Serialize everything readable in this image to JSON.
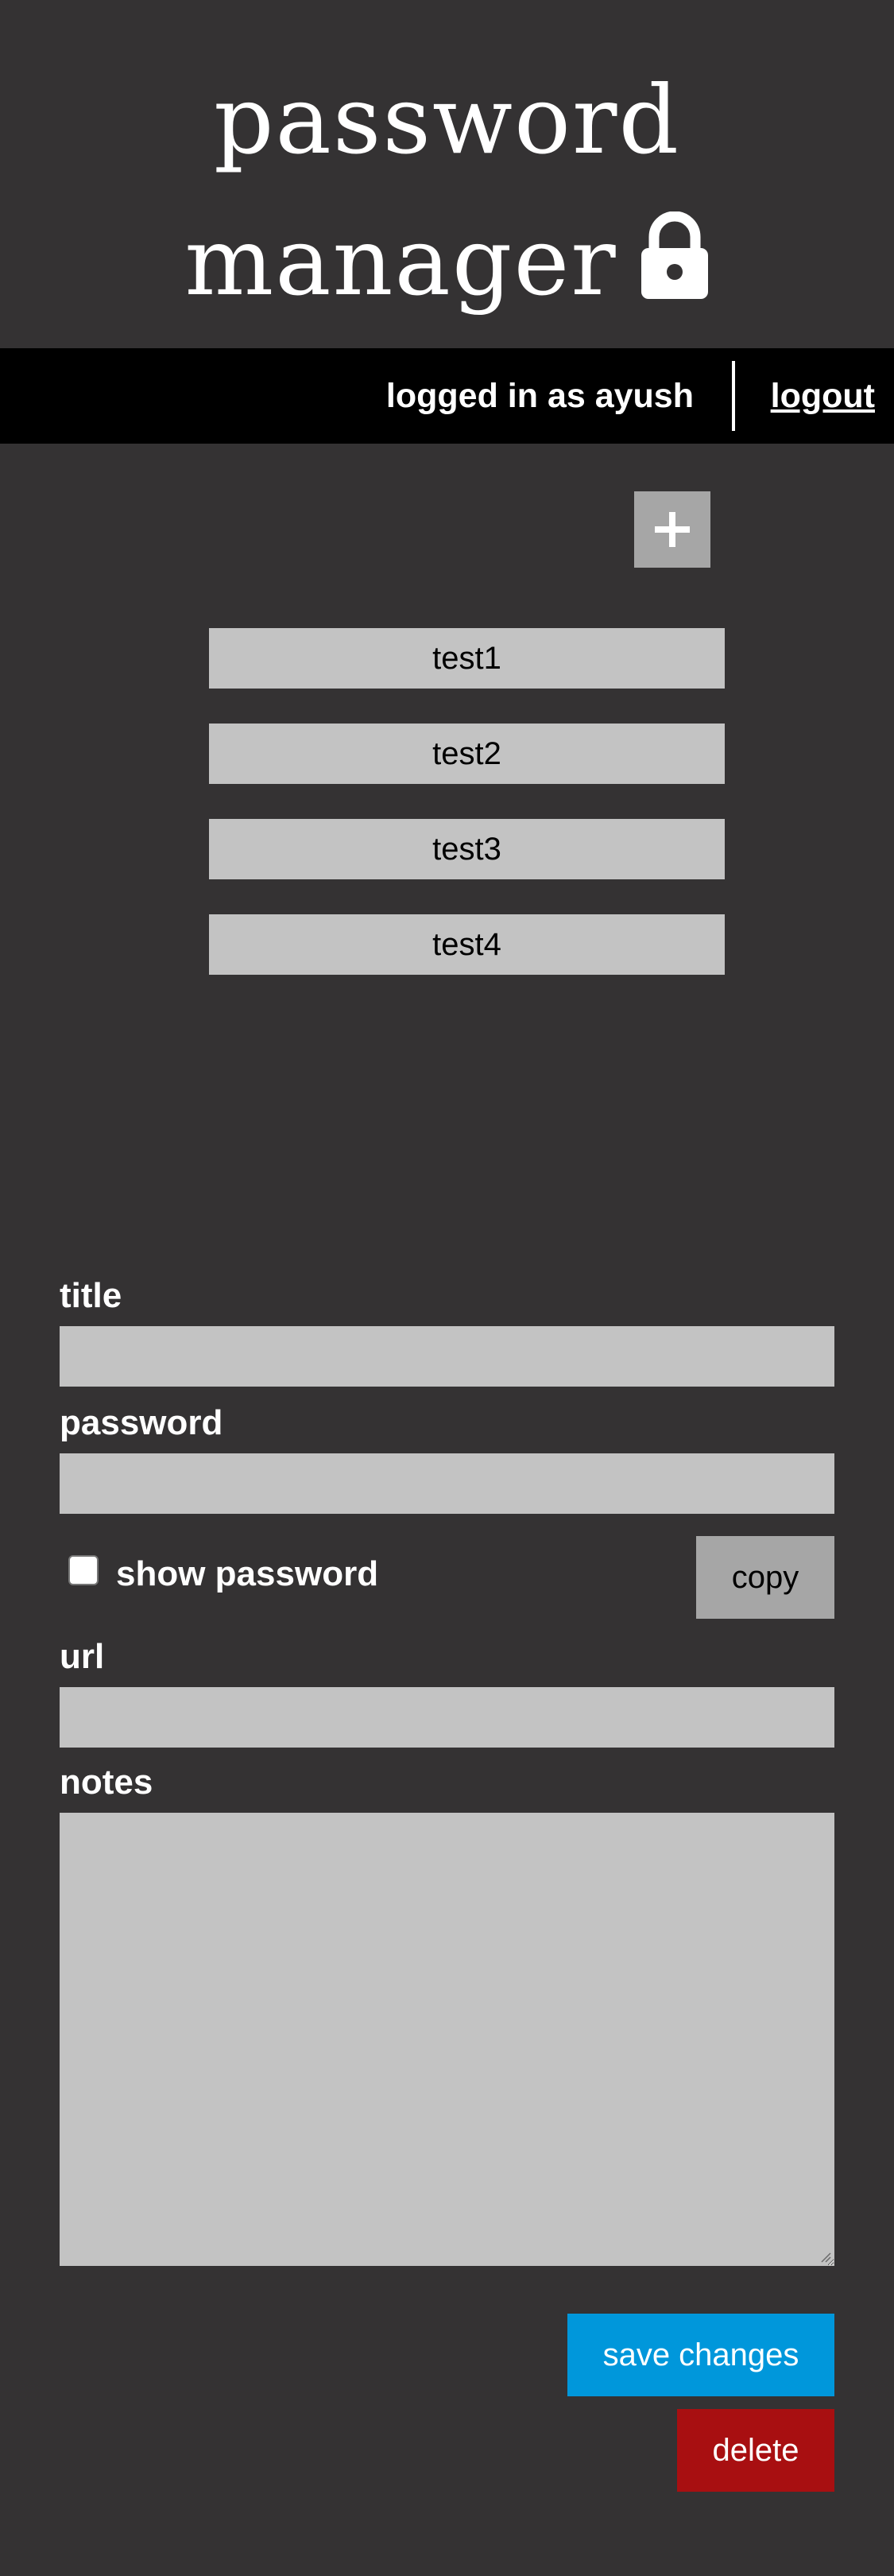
{
  "header": {
    "title_line1": "password",
    "title_line2": "manager",
    "icon": "lock-icon"
  },
  "userbar": {
    "status_text": "logged in as ayush",
    "logout_label": "logout"
  },
  "toolbar": {
    "add_icon": "plus-icon"
  },
  "entries": [
    {
      "label": "test1"
    },
    {
      "label": "test2"
    },
    {
      "label": "test3"
    },
    {
      "label": "test4"
    }
  ],
  "form": {
    "title_label": "title",
    "title_value": "",
    "password_label": "password",
    "password_value": "",
    "show_password_label": "show password",
    "show_password_checked": false,
    "copy_label": "copy",
    "url_label": "url",
    "url_value": "",
    "notes_label": "notes",
    "notes_value": "",
    "save_label": "save changes",
    "delete_label": "delete"
  },
  "colors": {
    "background": "#343233",
    "userbar": "#000000",
    "input_fill": "#c3c3c3",
    "button_gray": "#a6a6a6",
    "save_accent": "#0097db",
    "delete_accent": "#a80f11"
  }
}
